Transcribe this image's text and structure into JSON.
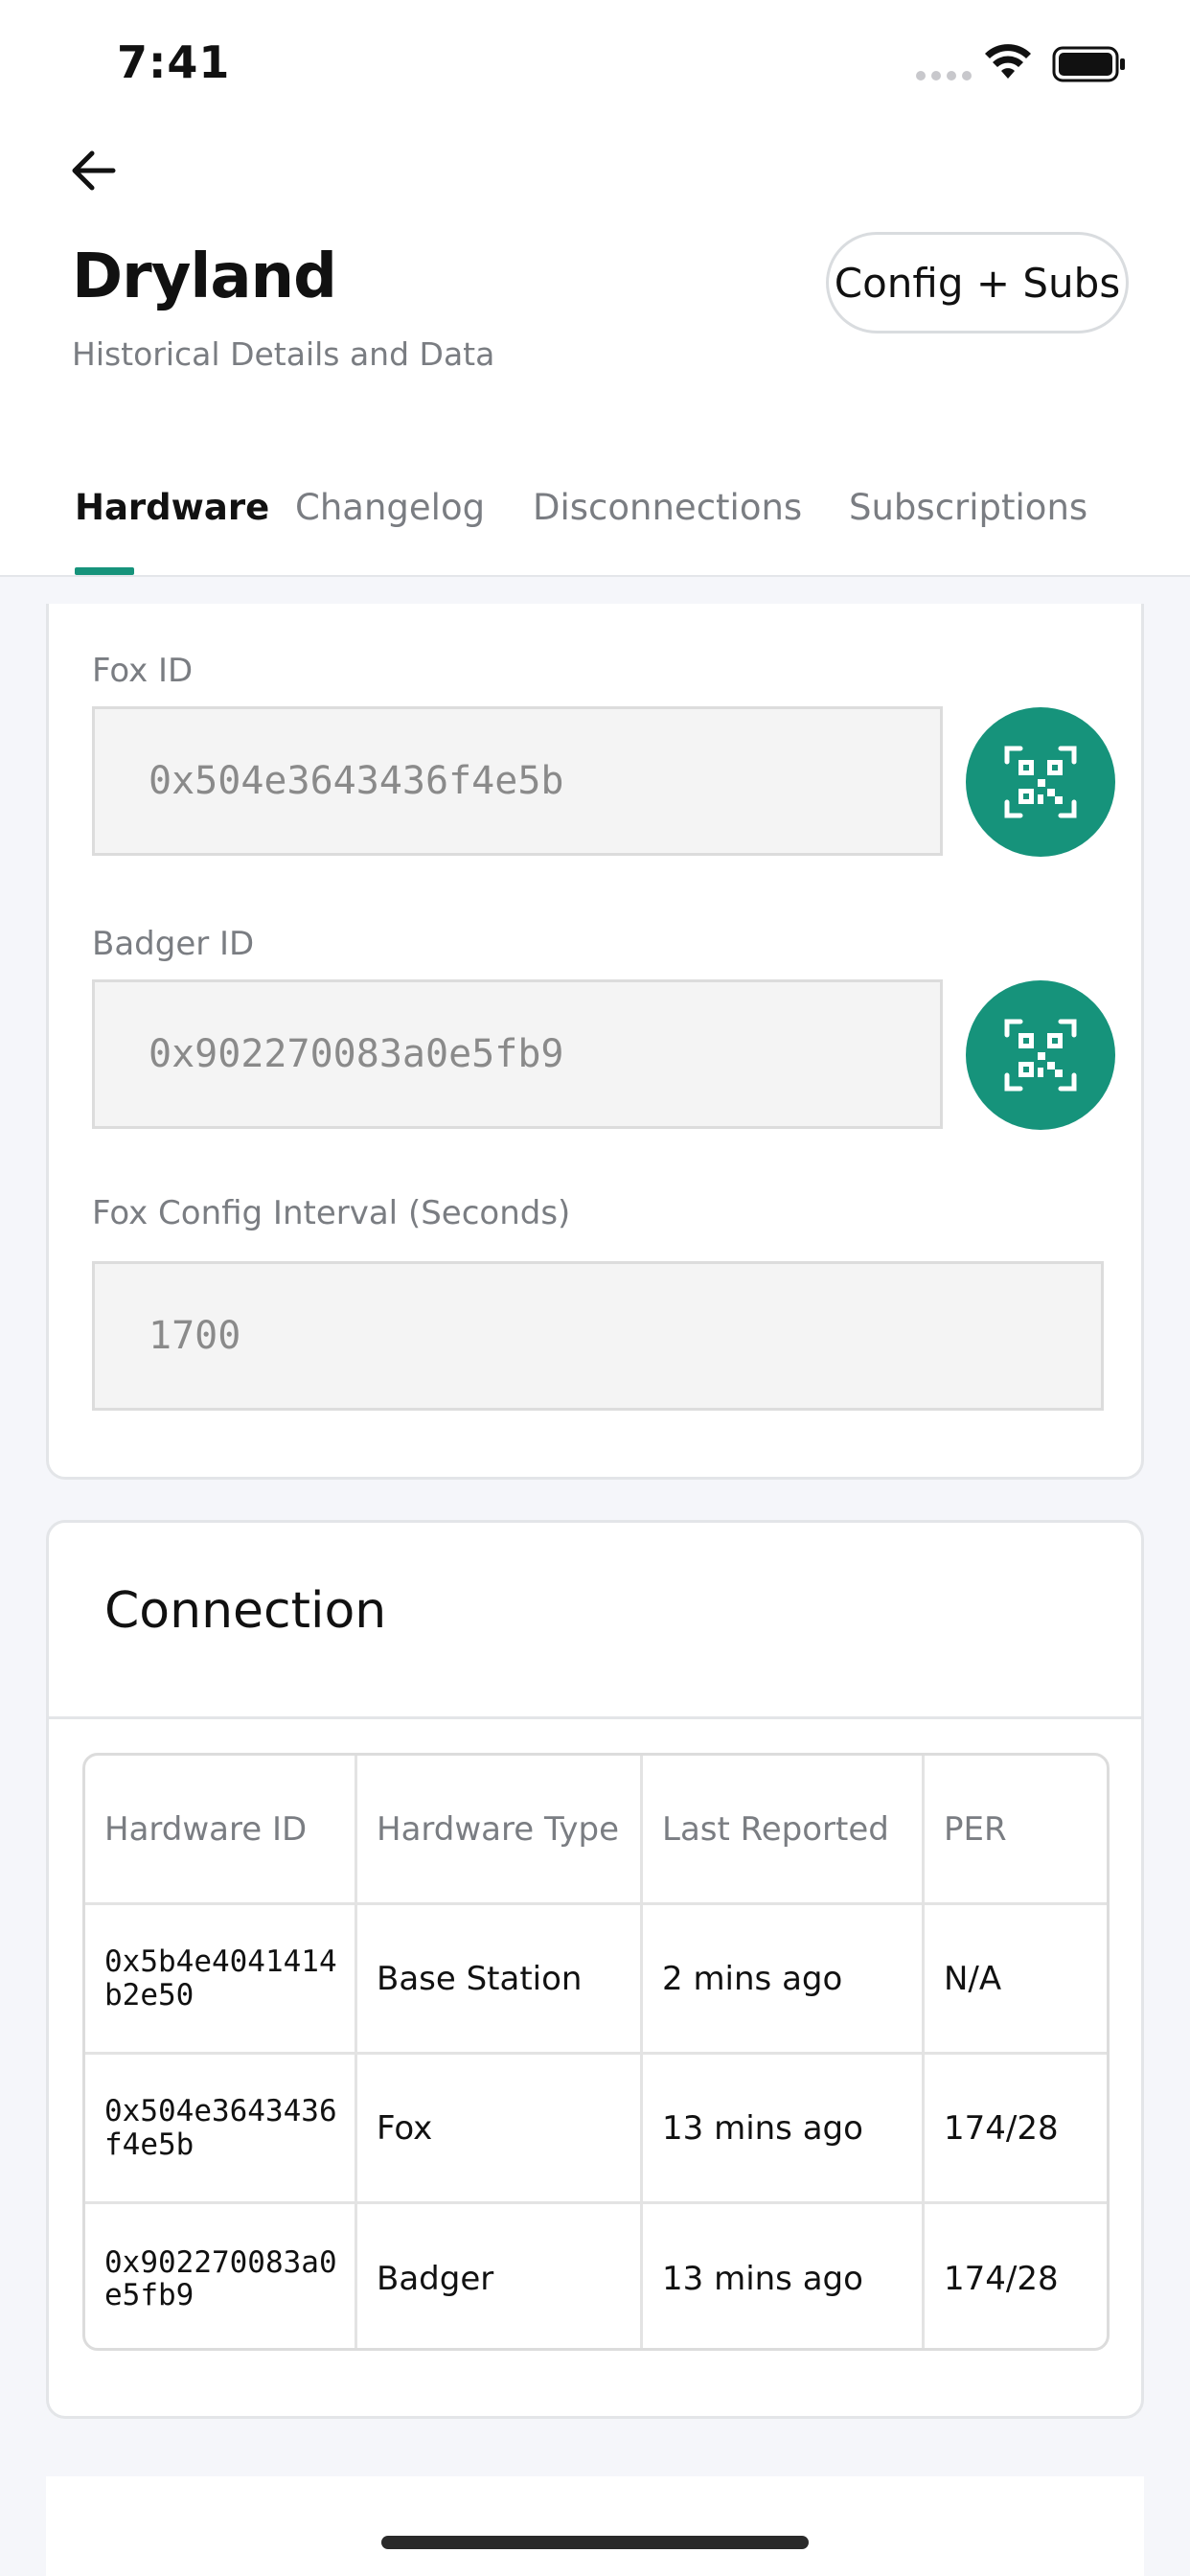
{
  "status_bar": {
    "time": "7:41",
    "icons": [
      "signal-dots-icon",
      "wifi-icon",
      "battery-icon"
    ]
  },
  "header": {
    "back_icon": "arrow-left-icon",
    "title": "Dryland",
    "subtitle": "Historical Details and Data",
    "config_button": "Config + Subs"
  },
  "tabs": [
    {
      "label": "Hardware",
      "active": true
    },
    {
      "label": "Changelog",
      "active": false
    },
    {
      "label": "Disconnections",
      "active": false
    },
    {
      "label": "Subscriptions",
      "active": false
    }
  ],
  "hardware_form": {
    "fox_id": {
      "label": "Fox ID",
      "value": "0x504e3643436f4e5b",
      "action_icon": "qr-scan-icon"
    },
    "badger_id": {
      "label": "Badger ID",
      "value": "0x902270083a0e5fb9",
      "action_icon": "qr-scan-icon"
    },
    "fox_config_interval": {
      "label": "Fox Config Interval (Seconds)",
      "value": "1700"
    }
  },
  "connection": {
    "title": "Connection",
    "columns": [
      "Hardware ID",
      "Hardware Type",
      "Last Reported",
      "PER"
    ],
    "rows": [
      [
        "0x5b4e4041414b2e50",
        "Base Station",
        "2 mins ago",
        "N/A"
      ],
      [
        "0x504e3643436f4e5b",
        "Fox",
        "13 mins ago",
        "174/28"
      ],
      [
        "0x902270083a0e5fb9",
        "Badger",
        "13 mins ago",
        "174/28"
      ]
    ]
  },
  "colors": {
    "accent": "#16937b",
    "background": "#f5f6fa",
    "muted_text": "#7a7d82"
  }
}
